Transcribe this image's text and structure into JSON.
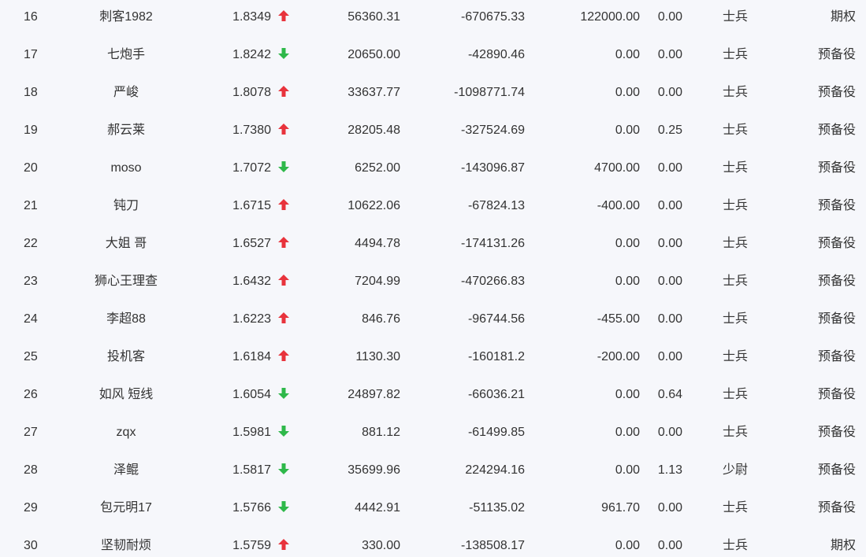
{
  "colors": {
    "up": "#e8333c",
    "down": "#2eb84a",
    "text": "#333333",
    "background": "#f6f7fb"
  },
  "rows": [
    {
      "rank": "16",
      "name": "刺客1982",
      "ratio": "1.8349",
      "trend": "up",
      "amount": "56360.31",
      "profit": "-670675.33",
      "delta": "122000.00",
      "pct": "0.00",
      "rank_title": "士兵",
      "type": "期权"
    },
    {
      "rank": "17",
      "name": "七炮手",
      "ratio": "1.8242",
      "trend": "down",
      "amount": "20650.00",
      "profit": "-42890.46",
      "delta": "0.00",
      "pct": "0.00",
      "rank_title": "士兵",
      "type": "预备役"
    },
    {
      "rank": "18",
      "name": "严峻",
      "ratio": "1.8078",
      "trend": "up",
      "amount": "33637.77",
      "profit": "-1098771.74",
      "delta": "0.00",
      "pct": "0.00",
      "rank_title": "士兵",
      "type": "预备役"
    },
    {
      "rank": "19",
      "name": "郝云莱",
      "ratio": "1.7380",
      "trend": "up",
      "amount": "28205.48",
      "profit": "-327524.69",
      "delta": "0.00",
      "pct": "0.25",
      "rank_title": "士兵",
      "type": "预备役"
    },
    {
      "rank": "20",
      "name": "moso",
      "ratio": "1.7072",
      "trend": "down",
      "amount": "6252.00",
      "profit": "-143096.87",
      "delta": "4700.00",
      "pct": "0.00",
      "rank_title": "士兵",
      "type": "预备役"
    },
    {
      "rank": "21",
      "name": "钝刀",
      "ratio": "1.6715",
      "trend": "up",
      "amount": "10622.06",
      "profit": "-67824.13",
      "delta": "-400.00",
      "pct": "0.00",
      "rank_title": "士兵",
      "type": "预备役"
    },
    {
      "rank": "22",
      "name": "大姐 哥",
      "ratio": "1.6527",
      "trend": "up",
      "amount": "4494.78",
      "profit": "-174131.26",
      "delta": "0.00",
      "pct": "0.00",
      "rank_title": "士兵",
      "type": "预备役"
    },
    {
      "rank": "23",
      "name": "狮心王理查",
      "ratio": "1.6432",
      "trend": "up",
      "amount": "7204.99",
      "profit": "-470266.83",
      "delta": "0.00",
      "pct": "0.00",
      "rank_title": "士兵",
      "type": "预备役"
    },
    {
      "rank": "24",
      "name": "李超88",
      "ratio": "1.6223",
      "trend": "up",
      "amount": "846.76",
      "profit": "-96744.56",
      "delta": "-455.00",
      "pct": "0.00",
      "rank_title": "士兵",
      "type": "预备役"
    },
    {
      "rank": "25",
      "name": "投机客",
      "ratio": "1.6184",
      "trend": "up",
      "amount": "1130.30",
      "profit": "-160181.2",
      "delta": "-200.00",
      "pct": "0.00",
      "rank_title": "士兵",
      "type": "预备役"
    },
    {
      "rank": "26",
      "name": "如风 短线",
      "ratio": "1.6054",
      "trend": "down",
      "amount": "24897.82",
      "profit": "-66036.21",
      "delta": "0.00",
      "pct": "0.64",
      "rank_title": "士兵",
      "type": "预备役"
    },
    {
      "rank": "27",
      "name": "zqx",
      "ratio": "1.5981",
      "trend": "down",
      "amount": "881.12",
      "profit": "-61499.85",
      "delta": "0.00",
      "pct": "0.00",
      "rank_title": "士兵",
      "type": "预备役"
    },
    {
      "rank": "28",
      "name": "泽鲲",
      "ratio": "1.5817",
      "trend": "down",
      "amount": "35699.96",
      "profit": "224294.16",
      "delta": "0.00",
      "pct": "1.13",
      "rank_title": "少尉",
      "type": "预备役"
    },
    {
      "rank": "29",
      "name": "包元明17",
      "ratio": "1.5766",
      "trend": "down",
      "amount": "4442.91",
      "profit": "-51135.02",
      "delta": "961.70",
      "pct": "0.00",
      "rank_title": "士兵",
      "type": "预备役"
    },
    {
      "rank": "30",
      "name": "坚韧耐烦",
      "ratio": "1.5759",
      "trend": "up",
      "amount": "330.00",
      "profit": "-138508.17",
      "delta": "0.00",
      "pct": "0.00",
      "rank_title": "士兵",
      "type": "期权"
    }
  ]
}
